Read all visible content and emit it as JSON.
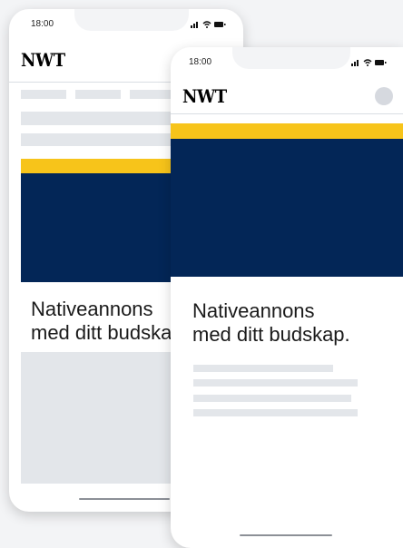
{
  "back_phone": {
    "status": {
      "time": "18:00"
    },
    "header": {
      "logo": "NWT"
    },
    "ad": {
      "headline_line1": "Nativeannons",
      "headline_line2": "med ditt budskap."
    },
    "colors": {
      "accent": "#f7c41a",
      "brand": "#032657",
      "placeholder": "#e3e6ea"
    }
  },
  "front_phone": {
    "status": {
      "time": "18:00"
    },
    "header": {
      "logo": "NWT",
      "avatar_icon": "avatar-icon"
    },
    "ad": {
      "headline_line1": "Nativeannons",
      "headline_line2": "med ditt budskap."
    },
    "colors": {
      "accent": "#f7c41a",
      "brand": "#032657",
      "placeholder": "#e3e6ea"
    }
  }
}
